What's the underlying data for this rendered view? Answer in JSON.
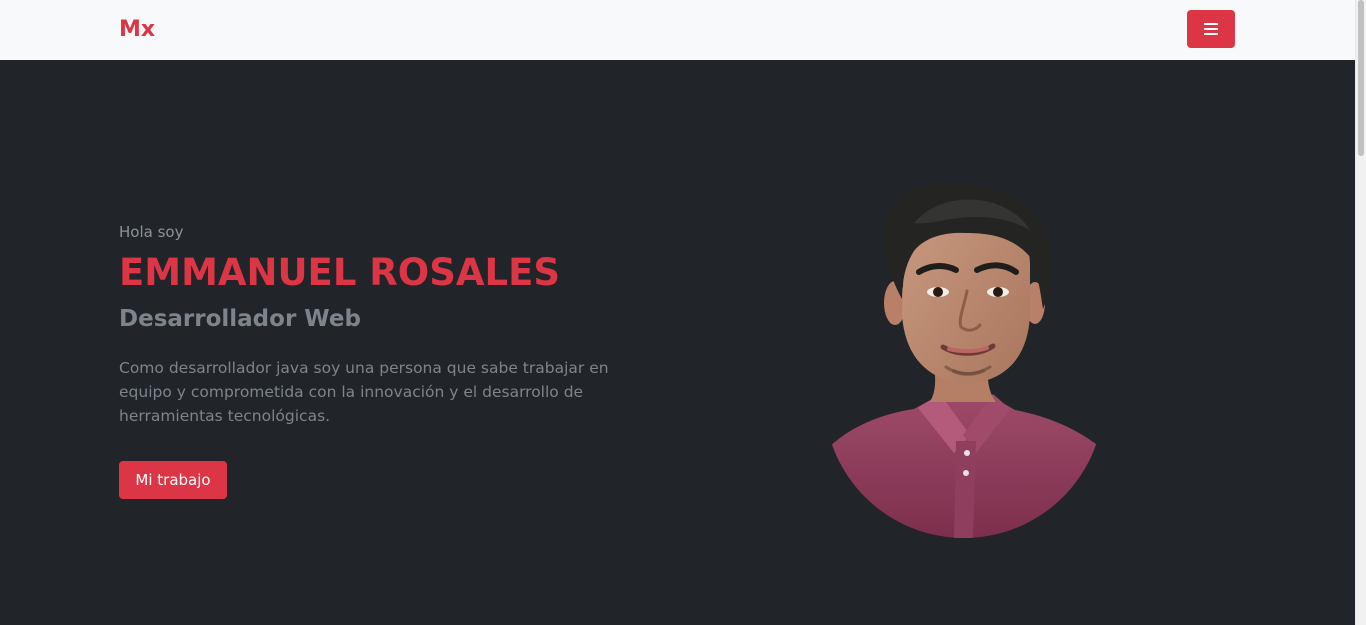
{
  "navbar": {
    "brand": "Mx",
    "menu_button": {
      "icon": "hamburger-menu-icon"
    }
  },
  "hero": {
    "greeting": "Hola soy",
    "name": "EMMANUEL ROSALES",
    "role": "Desarrollador Web",
    "description": "Como desarrollador java soy una persona que sabe trabajar en equipo y comprometida con la innovación y el desarrollo de herramientas tecnológicas.",
    "cta_label": "Mi trabajo",
    "image": "portrait-photo"
  },
  "colors": {
    "accent": "#dc3545",
    "navbar_bg": "#f8f9fa",
    "hero_bg": "#212529",
    "muted_text": "#7d848b"
  }
}
